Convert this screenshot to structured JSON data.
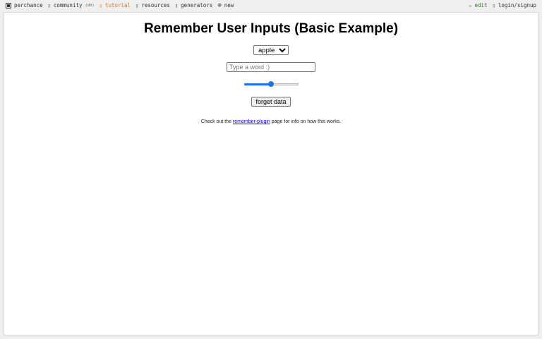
{
  "topbar": {
    "left_items": [
      {
        "label": "perchance",
        "icon": "dice-icon"
      },
      {
        "label": "community",
        "sub": "(dh)",
        "icon": "chat-icon"
      },
      {
        "label": "tutorial",
        "icon": "book-icon",
        "highlight": "#d97a1f"
      },
      {
        "label": "resources",
        "icon": "folder-icon"
      },
      {
        "label": "generators",
        "icon": "list-icon"
      },
      {
        "label": "new",
        "icon": "plus-circle-icon"
      }
    ],
    "right_items": [
      {
        "label": "edit",
        "icon": "pencil-icon",
        "highlight": "#2a7a2a"
      },
      {
        "label": "login/signup",
        "icon": "user-icon"
      }
    ]
  },
  "page": {
    "title": "Remember User Inputs (Basic Example)",
    "fruit_select": {
      "selected": "apple",
      "options": [
        "apple"
      ]
    },
    "word_input": {
      "value": "",
      "placeholder": "Type a word :)"
    },
    "slider": {
      "value": 50,
      "min": 0,
      "max": 100,
      "accent": "#1a73e8"
    },
    "forget_button_label": "forget data",
    "info": {
      "prefix": "Check out the ",
      "link_text": "remember-plugin",
      "suffix": " page for info on how this works."
    }
  }
}
